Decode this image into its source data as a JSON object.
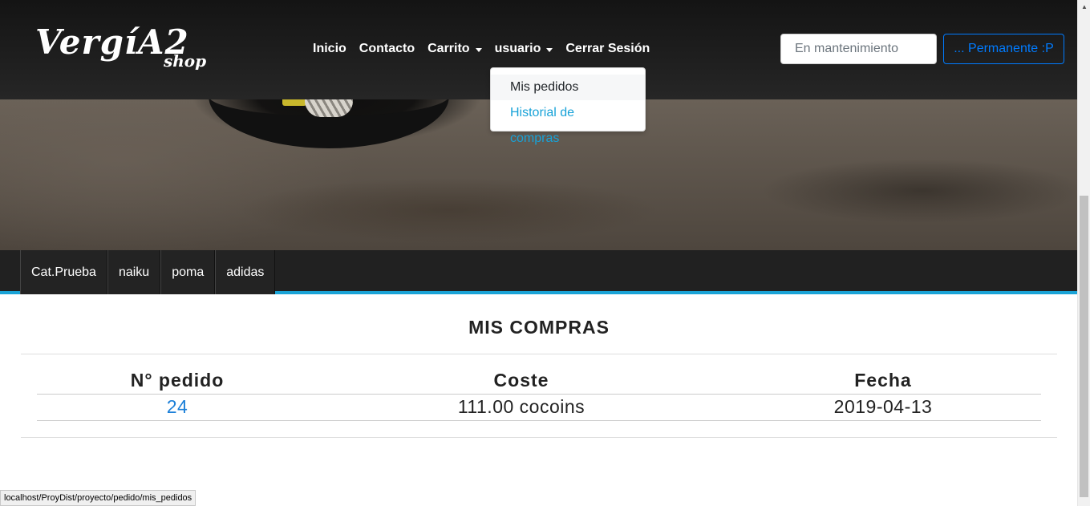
{
  "brand": {
    "logo_main": "VergíA2",
    "logo_sub": "shop"
  },
  "nav": {
    "items": [
      {
        "label": "Inicio",
        "has_caret": false
      },
      {
        "label": "Contacto",
        "has_caret": false
      },
      {
        "label": "Carrito",
        "has_caret": true
      },
      {
        "label": "usuario",
        "has_caret": true
      },
      {
        "label": "Cerrar Sesión",
        "has_caret": false
      }
    ]
  },
  "search": {
    "placeholder": "En mantenimiento",
    "value": ""
  },
  "perm_button": {
    "label": "... Permanente :P"
  },
  "user_dropdown": {
    "items": [
      {
        "label": "Mis pedidos",
        "hovered": true
      },
      {
        "label": "Historial de compras",
        "hovered": false
      }
    ]
  },
  "categories": [
    "Cat.Prueba",
    "naiku",
    "poma",
    "adidas"
  ],
  "main": {
    "title": "MIS COMPRAS",
    "columns": [
      "N° pedido",
      "Coste",
      "Fecha"
    ],
    "rows": [
      {
        "id": "24",
        "cost": "111.00 cocoins",
        "date": "2019-04-13"
      }
    ]
  },
  "status_url": "localhost/ProyDist/proyecto/pedido/mis_pedidos",
  "colors": {
    "accent": "#1aa3d6",
    "link": "#1b7fd8",
    "button_outline": "#007bff"
  }
}
